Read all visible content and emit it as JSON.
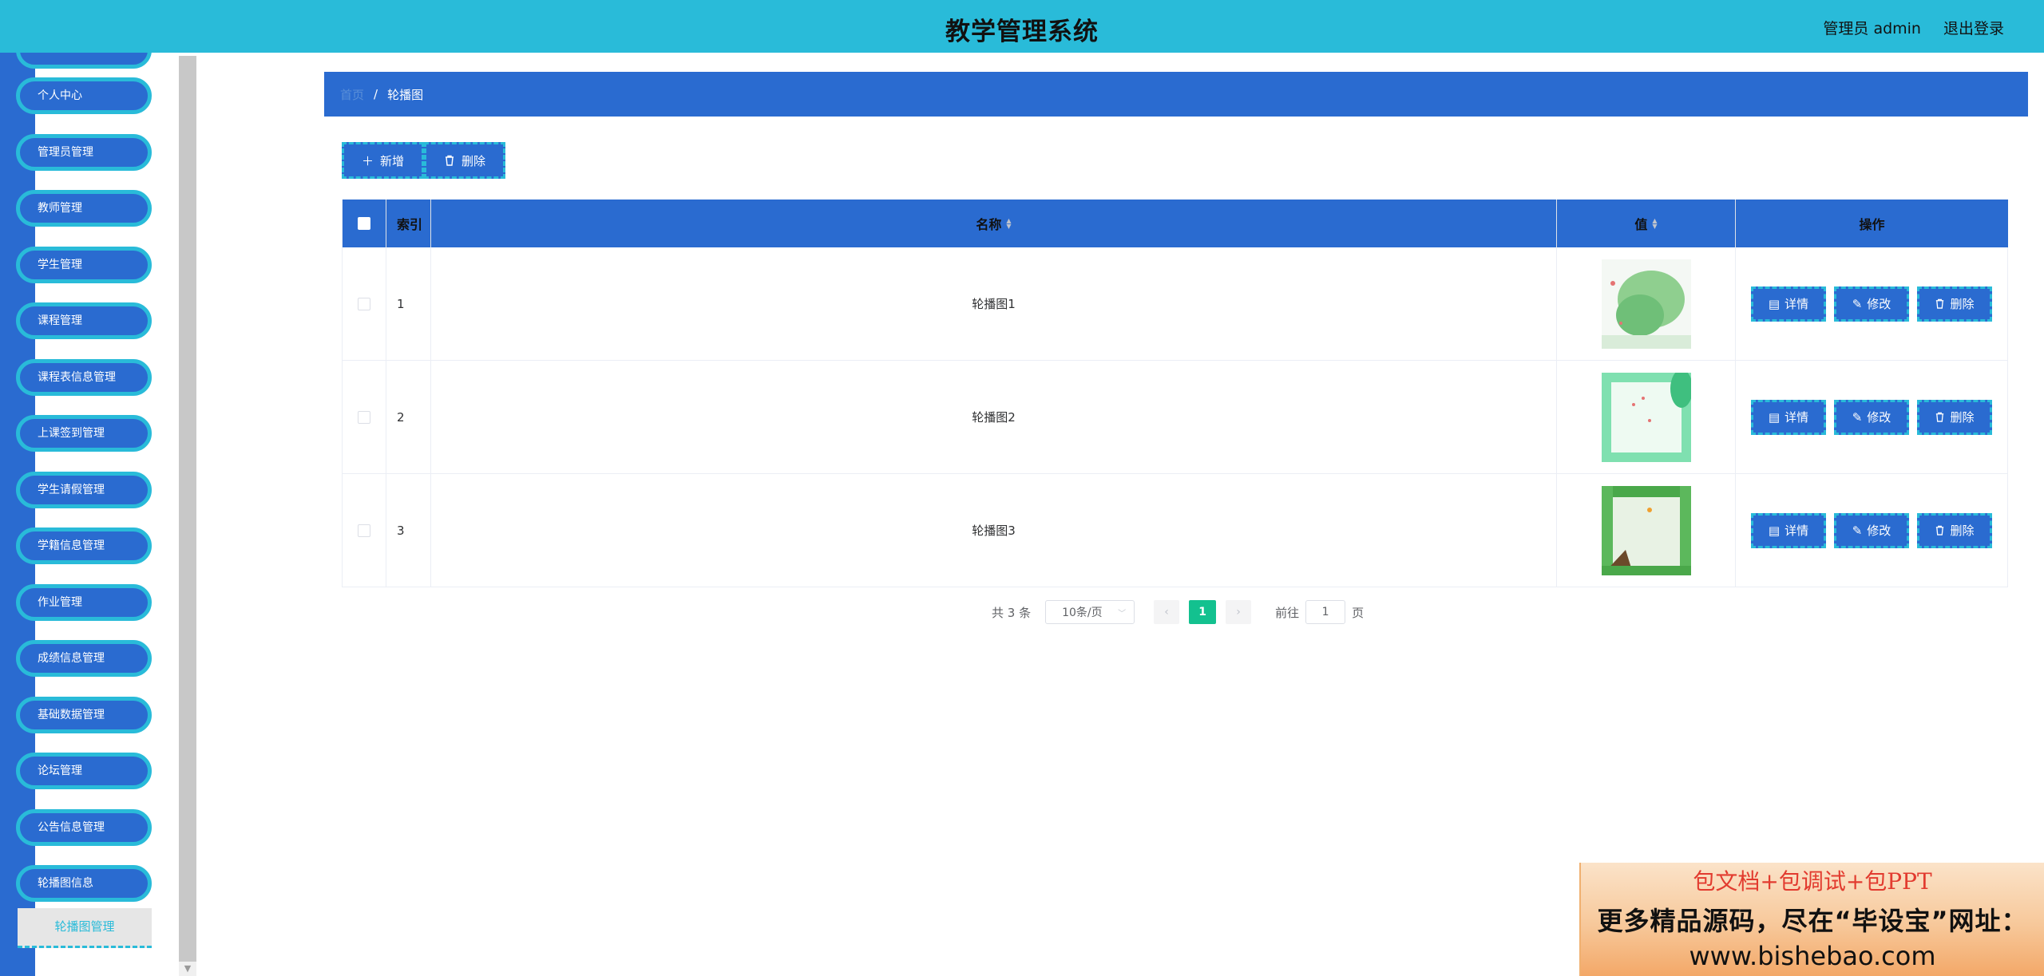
{
  "header": {
    "title": "教学管理系统",
    "user": "管理员 admin",
    "logout": "退出登录"
  },
  "sidebar": {
    "items": [
      "个人中心",
      "管理员管理",
      "教师管理",
      "学生管理",
      "课程管理",
      "课程表信息管理",
      "上课签到管理",
      "学生请假管理",
      "学籍信息管理",
      "作业管理",
      "成绩信息管理",
      "基础数据管理",
      "论坛管理",
      "公告信息管理",
      "轮播图信息"
    ],
    "active": "轮播图管理"
  },
  "breadcrumb": {
    "home": "首页",
    "separator": "/",
    "current": "轮播图"
  },
  "toolbar": {
    "add": "新增",
    "delete": "删除"
  },
  "table": {
    "headers": {
      "index": "索引",
      "name": "名称",
      "value": "值",
      "ops": "操作"
    },
    "rows": [
      {
        "index": "1",
        "name": "轮播图1"
      },
      {
        "index": "2",
        "name": "轮播图2"
      },
      {
        "index": "3",
        "name": "轮播图3"
      }
    ],
    "actions": {
      "detail": "详情",
      "edit": "修改",
      "delete": "删除"
    }
  },
  "pagination": {
    "total": "共 3 条",
    "page_size": "10条/页",
    "current": "1",
    "goto": "前往",
    "goto_value": "1",
    "page_unit": "页"
  },
  "ad": {
    "line1": "包文档+包调试+包PPT",
    "line2": "更多精品源码，尽在“毕设宝”网址：",
    "line3": "www.bishebao.com"
  },
  "colors": {
    "header": "#29bbd9",
    "primary": "#2a6bd0",
    "accent_border": "#29bbd9",
    "pager_active": "#13c18f"
  },
  "icons": {
    "add": "plus-icon",
    "delete": "trash-icon",
    "detail": "document-icon",
    "edit": "pencil-icon",
    "sort": "sort-caret-icon",
    "prev": "chevron-left-icon",
    "next": "chevron-right-icon",
    "dropdown": "chevron-down-icon"
  }
}
